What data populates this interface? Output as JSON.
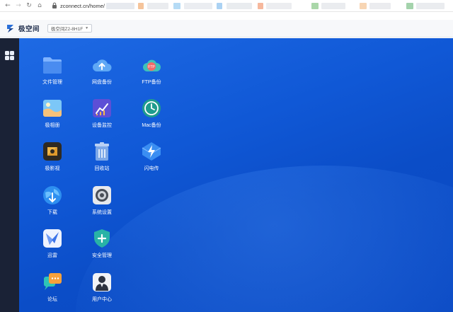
{
  "browser": {
    "url": "zconnect.cn/home/"
  },
  "header": {
    "brand": "极空间",
    "device_label": "极空间Z2-8H1F"
  },
  "desktop": {
    "apps": [
      {
        "label": "文件管理",
        "icon": "folder-icon"
      },
      {
        "label": "网盘备份",
        "icon": "cloud-upload-icon"
      },
      {
        "label": "FTP备份",
        "icon": "ftp-icon"
      },
      {
        "label": "极相册",
        "icon": "photo-album-icon"
      },
      {
        "label": "设备监控",
        "icon": "monitor-chart-icon"
      },
      {
        "label": "Mac备份",
        "icon": "time-machine-icon"
      },
      {
        "label": "极影视",
        "icon": "video-icon"
      },
      {
        "label": "回收站",
        "icon": "trash-icon"
      },
      {
        "label": "闪电传",
        "icon": "lightning-transfer-icon"
      },
      {
        "label": "下载",
        "icon": "download-globe-icon"
      },
      {
        "label": "系统设置",
        "icon": "settings-icon"
      },
      {
        "label": "迅雷",
        "icon": "xunlei-icon"
      },
      {
        "label": "安全管理",
        "icon": "security-shield-icon"
      },
      {
        "label": "论坛",
        "icon": "forum-chat-icon"
      },
      {
        "label": "用户中心",
        "icon": "user-center-icon"
      }
    ]
  },
  "colors": {
    "desktop_blue": "#1058d6",
    "sidebar_dark": "#1a2236"
  }
}
